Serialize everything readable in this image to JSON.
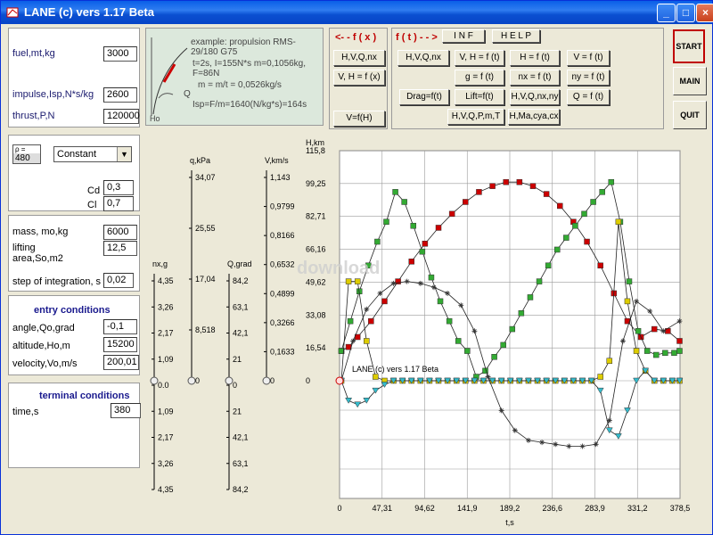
{
  "window": {
    "title": "LANE (c) vers 1.17 Beta",
    "controls": [
      "_",
      "□",
      "×"
    ]
  },
  "fuel_panel": {
    "fuel_label": "fuel,mt,kg",
    "fuel_value": "3000",
    "impulse_label": "impulse,Isp,N*s/kg",
    "impulse_value": "2600",
    "thrust_label": "thrust,P,N",
    "thrust_value": "120000"
  },
  "example": {
    "line1": "example: propulsion RMS-29/180 G75",
    "line2": "t=2s, I=155N*s m=0,1056kg, F=86N",
    "line3": "m = m/t = 0,0526kg/s",
    "line4": "Isp=F/m=1640(N/kg*s)=164s",
    "label_q": "Q",
    "label_ho": "Ho"
  },
  "fx_panel": {
    "label": "<- - f ( x )",
    "buttons": [
      "H,V,Q,nx",
      "V, H = f (x)",
      "V=f(H)"
    ]
  },
  "ft_panel": {
    "label": "f ( t ) - - >",
    "inf": "I N F",
    "help": "H E L P",
    "buttons": [
      "H,V,Q,nx",
      "V, H = f (t)",
      "H = f (t)",
      "V = f (t)",
      "g = f (t)",
      "nx = f (t)",
      "ny = f (t)",
      "Drag=f(t)",
      "Lift=f(t)",
      "H,V,Q,nx,ny",
      "Q = f (t)",
      "H,V,Q,P,m,T",
      "H,Ma,cya,cx"
    ]
  },
  "side_buttons": {
    "start": "START",
    "main": "MAIN",
    "quit": "QUIT"
  },
  "density_panel": {
    "rho_label": "ρ =",
    "rho_value": "480",
    "mode": "Constant",
    "cd_label": "Cd",
    "cd_value": "0,3",
    "cl_label": "Cl",
    "cl_value": "0,7"
  },
  "mass_panel": {
    "mass_label": "mass, mo,kg",
    "mass_value": "6000",
    "area_label_1": "lifting",
    "area_label_2": "area,So,m2",
    "area_value": "12,5",
    "step_label": "step of integration, s",
    "step_value": "0,02"
  },
  "entry": {
    "heading": "entry conditions",
    "angle_label": "angle,Qo,grad",
    "angle_value": "-0,1",
    "alt_label": "altitude,Ho,m",
    "alt_value": "15200",
    "vel_label": "velocity,Vo,m/s",
    "vel_value": "200,01"
  },
  "terminal": {
    "heading": "terminal conditions",
    "time_label": "time,s",
    "time_value": "380"
  },
  "scales": {
    "nx": {
      "title": "nx,g",
      "ticks": [
        "4,35",
        "3,26",
        "2,17",
        "1,09",
        "0.0",
        "1,09",
        "2,17",
        "3,26",
        "4,35"
      ]
    },
    "q": {
      "title": "q,kPa",
      "ticks": [
        "34,07",
        "25,55",
        "17,04",
        "8,518",
        "0"
      ]
    },
    "theta": {
      "title": "Q,grad",
      "ticks": [
        "84,2",
        "63,1",
        "42,1",
        "21",
        "0",
        "21",
        "42,1",
        "63,1",
        "84,2"
      ]
    },
    "v": {
      "title": "V,km/s",
      "ticks": [
        "1,143",
        "0,9799",
        "0,8166",
        "0,6532",
        "0,4899",
        "0,3266",
        "0,1633",
        "0"
      ]
    }
  },
  "watermark": "download",
  "chart_data": {
    "type": "line",
    "title": "",
    "xlabel": "t,s",
    "ylabel": "H,km",
    "xlim": [
      0,
      378.5
    ],
    "ylim": [
      0,
      115.8
    ],
    "x_ticks": [
      "0",
      "47,31",
      "94,62",
      "141,9",
      "189,2",
      "236,6",
      "283,9",
      "331,2",
      "378,5"
    ],
    "y_ticks": [
      "115,8",
      "99,25",
      "82,71",
      "66,16",
      "49,62",
      "33,08",
      "16,54",
      "0"
    ],
    "annotation": "LANE (c) vers 1.17 Beta",
    "series": [
      {
        "color": "#cc0000",
        "marker": "square",
        "x": [
          2,
          10,
          20,
          35,
          50,
          65,
          80,
          95,
          110,
          125,
          140,
          155,
          170,
          185,
          200,
          215,
          230,
          245,
          260,
          275,
          290,
          305,
          320,
          335,
          350,
          365,
          378
        ],
        "y": [
          15,
          17,
          22,
          30,
          40,
          50,
          60,
          69,
          77,
          84,
          90,
          95,
          98,
          100,
          100,
          98,
          94,
          88,
          80,
          70,
          58,
          44,
          30,
          22,
          26,
          25,
          20
        ]
      },
      {
        "color": "#33aa33",
        "marker": "square",
        "x": [
          2,
          12,
          22,
          32,
          42,
          52,
          62,
          72,
          82,
          92,
          102,
          112,
          122,
          132,
          142,
          152,
          162,
          172,
          182,
          192,
          202,
          212,
          222,
          232,
          242,
          252,
          262,
          272,
          282,
          292,
          302,
          312,
          322,
          332,
          342,
          352,
          362,
          372,
          378
        ],
        "y": [
          15,
          30,
          45,
          58,
          70,
          80,
          95,
          90,
          78,
          65,
          52,
          40,
          30,
          20,
          15,
          2,
          5,
          12,
          18,
          26,
          34,
          42,
          50,
          58,
          66,
          72,
          78,
          84,
          90,
          95,
          100,
          80,
          50,
          25,
          15,
          13,
          14,
          14,
          15
        ]
      },
      {
        "color": "#ddcc00",
        "marker": "xsquare",
        "x": [
          2,
          10,
          20,
          30,
          40,
          50,
          60,
          70,
          80,
          90,
          100,
          110,
          120,
          130,
          140,
          150,
          160,
          170,
          180,
          190,
          200,
          210,
          220,
          230,
          240,
          250,
          260,
          270,
          280,
          290,
          300,
          310,
          320,
          330,
          340,
          350,
          360,
          370,
          378
        ],
        "y": [
          0,
          50,
          50,
          20,
          2,
          0,
          0,
          0,
          0,
          0,
          0,
          0,
          0,
          0,
          0,
          0,
          0,
          0,
          0,
          0,
          0,
          0,
          0,
          0,
          0,
          0,
          0,
          0,
          0,
          2,
          10,
          80,
          40,
          15,
          5,
          0,
          0,
          0,
          0
        ]
      },
      {
        "color": "#333333",
        "marker": "star",
        "x": [
          2,
          15,
          30,
          45,
          60,
          75,
          90,
          105,
          120,
          135,
          150,
          165,
          180,
          195,
          210,
          225,
          240,
          255,
          270,
          285,
          300,
          315,
          330,
          345,
          360,
          378
        ],
        "y": [
          0,
          20,
          36,
          44,
          49,
          50,
          49,
          47,
          44,
          38,
          25,
          2,
          -15,
          -25,
          -30,
          -31,
          -32,
          -33,
          -33,
          -32,
          -20,
          20,
          40,
          35,
          25,
          30
        ]
      },
      {
        "color": "#33bbcc",
        "marker": "triangle",
        "x": [
          2,
          10,
          20,
          30,
          40,
          50,
          60,
          70,
          80,
          90,
          100,
          110,
          120,
          130,
          140,
          150,
          160,
          170,
          180,
          190,
          200,
          210,
          220,
          230,
          240,
          250,
          260,
          270,
          280,
          290,
          300,
          310,
          320,
          330,
          340,
          350,
          360,
          370,
          378
        ],
        "y": [
          0,
          -10,
          -12,
          -10,
          -5,
          -2,
          0,
          0,
          0,
          0,
          0,
          0,
          0,
          0,
          0,
          0,
          0,
          0,
          0,
          0,
          0,
          0,
          0,
          0,
          0,
          0,
          0,
          0,
          0,
          -5,
          -25,
          -28,
          -15,
          0,
          5,
          0,
          0,
          0,
          0
        ]
      }
    ]
  }
}
